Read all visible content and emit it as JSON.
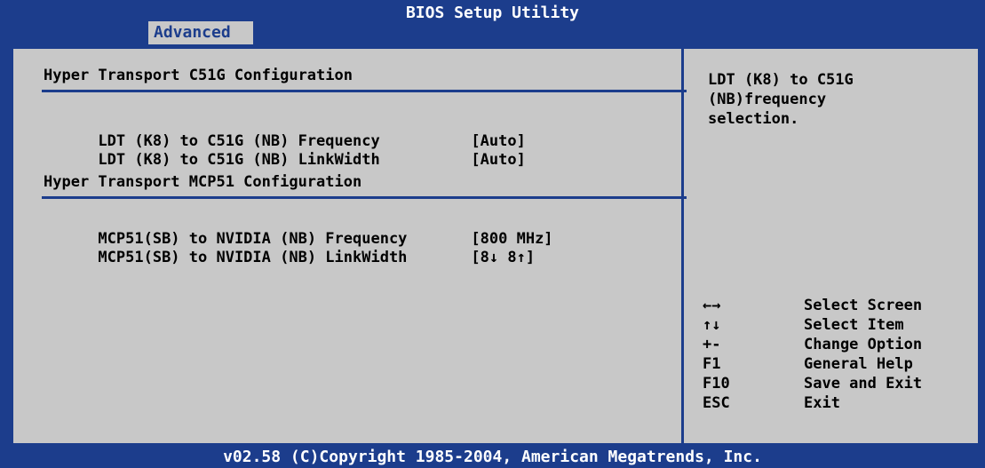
{
  "window": {
    "title": "BIOS Setup Utility"
  },
  "menu": {
    "active_tab": "Advanced"
  },
  "sections": [
    {
      "title": "Hyper Transport C51G Configuration",
      "items": [
        {
          "label": "LDT (K8) to C51G (NB) Frequency",
          "value": "[Auto]"
        },
        {
          "label": "LDT (K8) to C51G (NB) LinkWidth",
          "value": "[Auto]"
        }
      ]
    },
    {
      "title": "Hyper Transport MCP51 Configuration",
      "items": [
        {
          "label": "MCP51(SB) to NVIDIA (NB) Frequency",
          "value": "[800 MHz]"
        },
        {
          "label": "MCP51(SB) to NVIDIA (NB) LinkWidth",
          "value": "[8↓ 8↑]"
        }
      ]
    }
  ],
  "help_text": "LDT (K8) to C51G\n(NB)frequency\nselection.",
  "keys": [
    {
      "key": "←→",
      "action": "Select Screen"
    },
    {
      "key": "↑↓",
      "action": "Select Item"
    },
    {
      "key": "+-",
      "action": "Change Option"
    },
    {
      "key": "F1",
      "action": "General Help"
    },
    {
      "key": "F10",
      "action": "Save and Exit"
    },
    {
      "key": "ESC",
      "action": "Exit"
    }
  ],
  "footer": "v02.58 (C)Copyright 1985-2004, American Megatrends, Inc.",
  "colors": {
    "background": "#1c3d8c",
    "panel": "#c8c8c8",
    "text": "#000000",
    "title_text": "#ffffff"
  }
}
